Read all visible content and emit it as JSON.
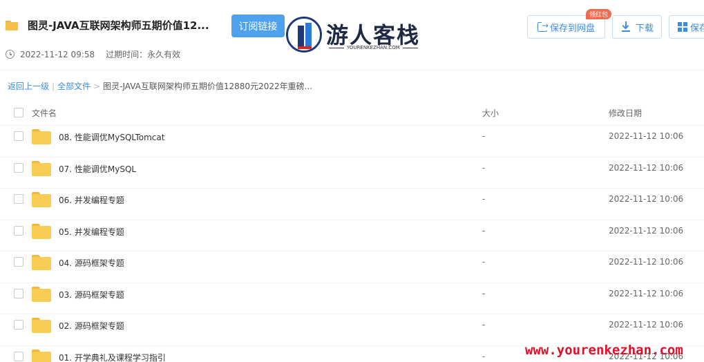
{
  "header": {
    "title": "图灵-JAVA互联网架构师五期价值12...",
    "subscribe_label": "订阅链接",
    "logo_text": "游人客栈",
    "logo_sub": "YOURENKEZHAN.COM",
    "share_time": "2022-11-12 09:58",
    "expire_label": "过期时间：永久有效",
    "save_label": "保存到网盘",
    "badge_label": "领红包",
    "download_label": "下载",
    "save2_label": "保存"
  },
  "breadcrumb": {
    "back": "返回上一级",
    "sep": "|",
    "all_files": "全部文件",
    "arrow": ">",
    "current": "图灵-JAVA互联网架构师五期价值12880元2022年重磅..."
  },
  "table": {
    "columns": {
      "name": "文件名",
      "size": "大小",
      "date": "修改日期"
    },
    "rows": [
      {
        "name": "08. 性能调优MySQLTomcat",
        "size": "-",
        "date": "2022-11-12 10:06"
      },
      {
        "name": "07. 性能调优MySQL",
        "size": "-",
        "date": "2022-11-12 10:06"
      },
      {
        "name": "06. 并发编程专题",
        "size": "-",
        "date": "2022-11-12 10:06"
      },
      {
        "name": "05. 并发编程专题",
        "size": "-",
        "date": "2022-11-12 10:06"
      },
      {
        "name": "04. 源码框架专题",
        "size": "-",
        "date": "2022-11-12 10:06"
      },
      {
        "name": "03. 源码框架专题",
        "size": "-",
        "date": "2022-11-12 10:06"
      },
      {
        "name": "02. 源码框架专题",
        "size": "-",
        "date": "2022-11-12 10:06"
      },
      {
        "name": "01. 开学典礼及课程学习指引",
        "size": "-",
        "date": "2022-11-12 10:06"
      }
    ]
  },
  "watermark": "www.yourenkezhan.com",
  "colors": {
    "accent": "#3b8de0",
    "folder": "#f8cc55",
    "badge": "#f26a4f",
    "watermark": "#e0102a"
  }
}
